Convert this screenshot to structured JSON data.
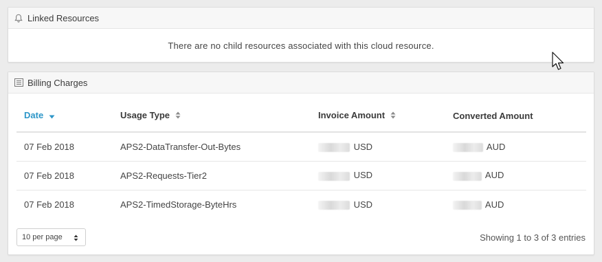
{
  "linked": {
    "title": "Linked Resources",
    "icon": "bell-icon",
    "empty_message": "There are no child resources associated with this cloud resource."
  },
  "billing": {
    "title": "Billing Charges",
    "icon": "list-icon",
    "columns": [
      {
        "label": "Date",
        "sort": "desc"
      },
      {
        "label": "Usage Type",
        "sort": "both"
      },
      {
        "label": "Invoice Amount",
        "sort": "both"
      },
      {
        "label": "Converted Amount",
        "sort": "none"
      }
    ],
    "rows": [
      {
        "date": "07 Feb 2018",
        "usage_type": "APS2-DataTransfer-Out-Bytes",
        "invoice_currency": "USD",
        "converted_currency": "AUD"
      },
      {
        "date": "07 Feb 2018",
        "usage_type": "APS2-Requests-Tier2",
        "invoice_currency": "USD",
        "converted_currency": "AUD"
      },
      {
        "date": "07 Feb 2018",
        "usage_type": "APS2-TimedStorage-ByteHrs",
        "invoice_currency": "USD",
        "converted_currency": "AUD"
      }
    ],
    "per_page": "10 per page",
    "showing": "Showing 1 to 3 of 3 entries"
  },
  "colors": {
    "accent": "#2d96c8",
    "background": "#ececec"
  }
}
